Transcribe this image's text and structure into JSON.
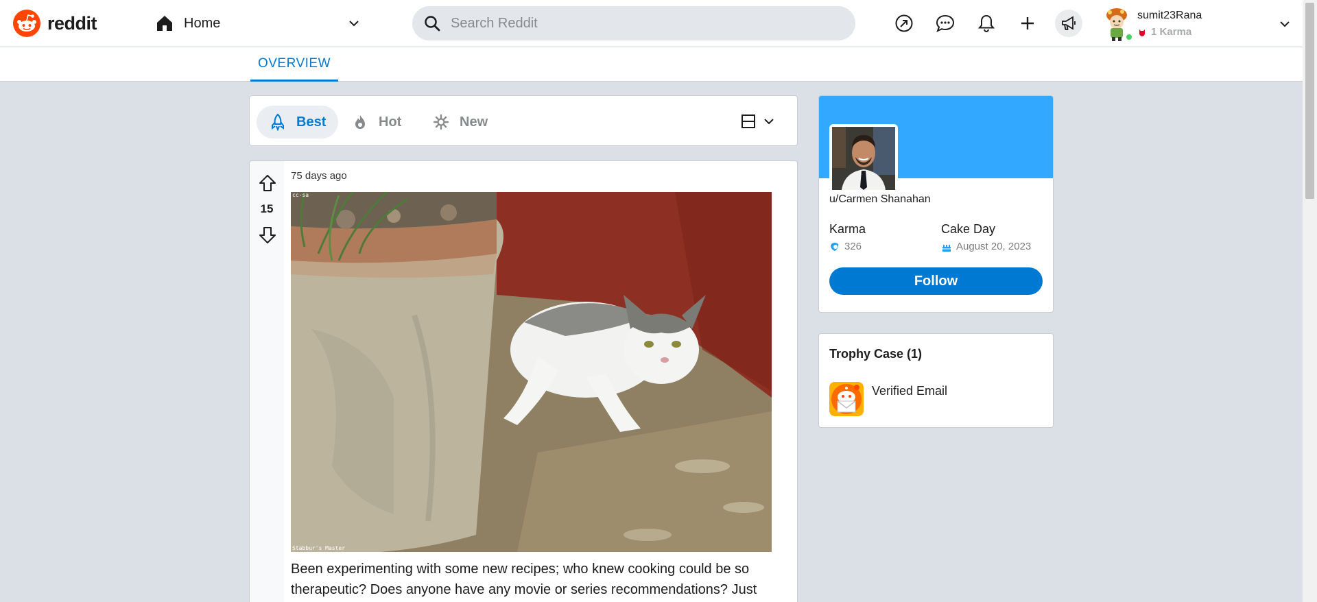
{
  "header": {
    "logo_text": "reddit",
    "home_label": "Home",
    "search_placeholder": "Search Reddit",
    "user": {
      "username": "sumit23Rana",
      "karma": "1 Karma"
    },
    "icons": [
      "popular-icon",
      "chat-icon",
      "notification-bell-icon",
      "create-post-icon",
      "advertise-icon"
    ]
  },
  "tabs": {
    "overview": "OVERVIEW"
  },
  "sort": {
    "options": [
      {
        "label": "Best",
        "icon": "rocket-icon",
        "active": true
      },
      {
        "label": "Hot",
        "icon": "flame-icon",
        "active": false
      },
      {
        "label": "New",
        "icon": "sparkle-icon",
        "active": false
      }
    ]
  },
  "post": {
    "time": "75 days ago",
    "score": "15",
    "image_alt": "Cat lying beside a clay plant pot",
    "image_caption_top": "cc-sa",
    "image_caption_bottom": "Stabbur's Master",
    "body": "Been experimenting with some new recipes; who knew cooking could be so therapeutic? Does anyone have any movie or series recommendations? Just"
  },
  "profile": {
    "username": "u/Carmen Shanahan",
    "karma_label": "Karma",
    "karma_value": "326",
    "cakeday_label": "Cake Day",
    "cakeday_value": "August 20, 2023",
    "follow_label": "Follow"
  },
  "trophy": {
    "title": "Trophy Case (1)",
    "items": [
      {
        "name": "Verified Email"
      }
    ]
  },
  "colors": {
    "brand": "#ff4500",
    "accent": "#0079d3",
    "banner": "#33a8ff",
    "background": "#dae0e6"
  }
}
